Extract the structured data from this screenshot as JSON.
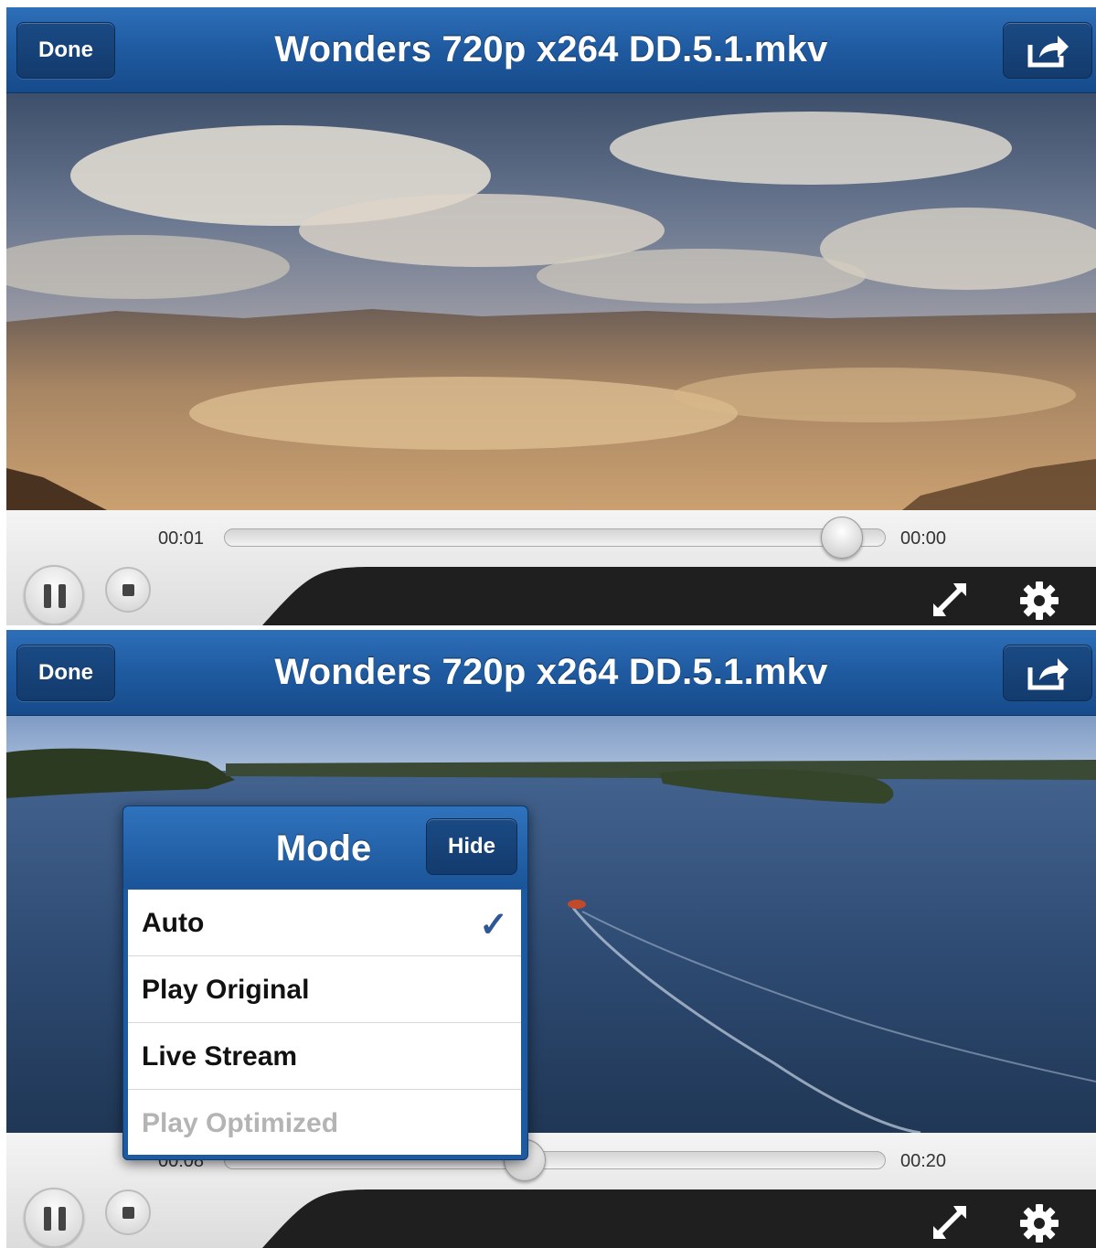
{
  "colors": {
    "nav_blue": "#1f5aa0",
    "check_blue": "#2d5795",
    "disabled_gray": "#b4b4b4"
  },
  "screens": [
    {
      "nav": {
        "done_label": "Done",
        "title": "Wonders 720p x264 DD.5.1.mkv",
        "share_icon": "share-icon"
      },
      "controls": {
        "time_elapsed": "00:01",
        "time_remaining": "00:00",
        "progress": 0.96,
        "pause_icon": "pause-icon",
        "stop_icon": "stop-icon",
        "fullscreen_icon": "fullscreen-icon",
        "settings_icon": "gear-icon"
      }
    },
    {
      "nav": {
        "done_label": "Done",
        "title": "Wonders 720p x264 DD.5.1.mkv",
        "share_icon": "share-icon"
      },
      "controls": {
        "time_elapsed": "00:08",
        "time_remaining": "00:20",
        "progress": 0.45,
        "pause_icon": "pause-icon",
        "stop_icon": "stop-icon",
        "fullscreen_icon": "fullscreen-icon",
        "settings_icon": "gear-icon"
      },
      "mode_popover": {
        "title": "Mode",
        "hide_label": "Hide",
        "items": [
          {
            "label": "Auto",
            "selected": true,
            "enabled": true
          },
          {
            "label": "Play Original",
            "selected": false,
            "enabled": true
          },
          {
            "label": "Live Stream",
            "selected": false,
            "enabled": true
          },
          {
            "label": "Play Optimized",
            "selected": false,
            "enabled": false
          }
        ],
        "check_mark": "✓"
      }
    }
  ]
}
